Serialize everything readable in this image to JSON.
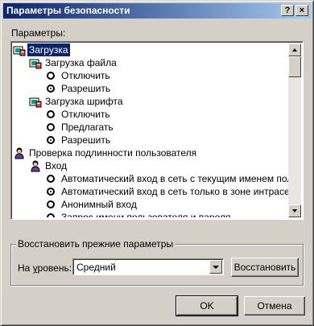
{
  "window": {
    "title": "Параметры безопасности",
    "help_glyph": "?",
    "close_glyph": "×"
  },
  "settings_label": "Параметры:",
  "tree": [
    {
      "label": "Загрузка",
      "kind": "category",
      "icon": "settings-folder-icon",
      "indent": 0,
      "selected": true
    },
    {
      "label": "Загрузка файла",
      "kind": "category",
      "icon": "settings-folder-icon",
      "indent": 1
    },
    {
      "label": "Отключить",
      "kind": "radio",
      "indent": 2,
      "checked": false
    },
    {
      "label": "Разрешить",
      "kind": "radio",
      "indent": 2,
      "checked": true
    },
    {
      "label": "Загрузка шрифта",
      "kind": "category",
      "icon": "settings-folder-icon",
      "indent": 1
    },
    {
      "label": "Отключить",
      "kind": "radio",
      "indent": 2,
      "checked": false
    },
    {
      "label": "Предлагать",
      "kind": "radio",
      "indent": 2,
      "checked": false
    },
    {
      "label": "Разрешить",
      "kind": "radio",
      "indent": 2,
      "checked": true
    },
    {
      "label": "Проверка подлинности пользователя",
      "kind": "category",
      "icon": "user-icon",
      "indent": 0
    },
    {
      "label": "Вход",
      "kind": "category",
      "icon": "user-icon",
      "indent": 1
    },
    {
      "label": "Автоматический вход в сеть с текущим именем пользоватля",
      "kind": "radio",
      "indent": 2,
      "checked": false
    },
    {
      "label": "Автоматический вход в сеть только в зоне интрасети",
      "kind": "radio",
      "indent": 2,
      "checked": true
    },
    {
      "label": "Анонимный вход",
      "kind": "radio",
      "indent": 2,
      "checked": false
    },
    {
      "label": "Запрос имени пользователя и пароля",
      "kind": "radio",
      "indent": 2,
      "checked": false
    }
  ],
  "reset": {
    "group_title": "Восстановить прежние параметры",
    "level_label": "На уровень:",
    "level_value": "Средний",
    "restore_button": "Восстановить"
  },
  "buttons": {
    "ok": "OK",
    "cancel": "Отмена"
  },
  "colors": {
    "titlebar_start": "#0a246a",
    "titlebar_end": "#a6caf0",
    "face": "#d4d0c8",
    "selection": "#0a246a"
  }
}
